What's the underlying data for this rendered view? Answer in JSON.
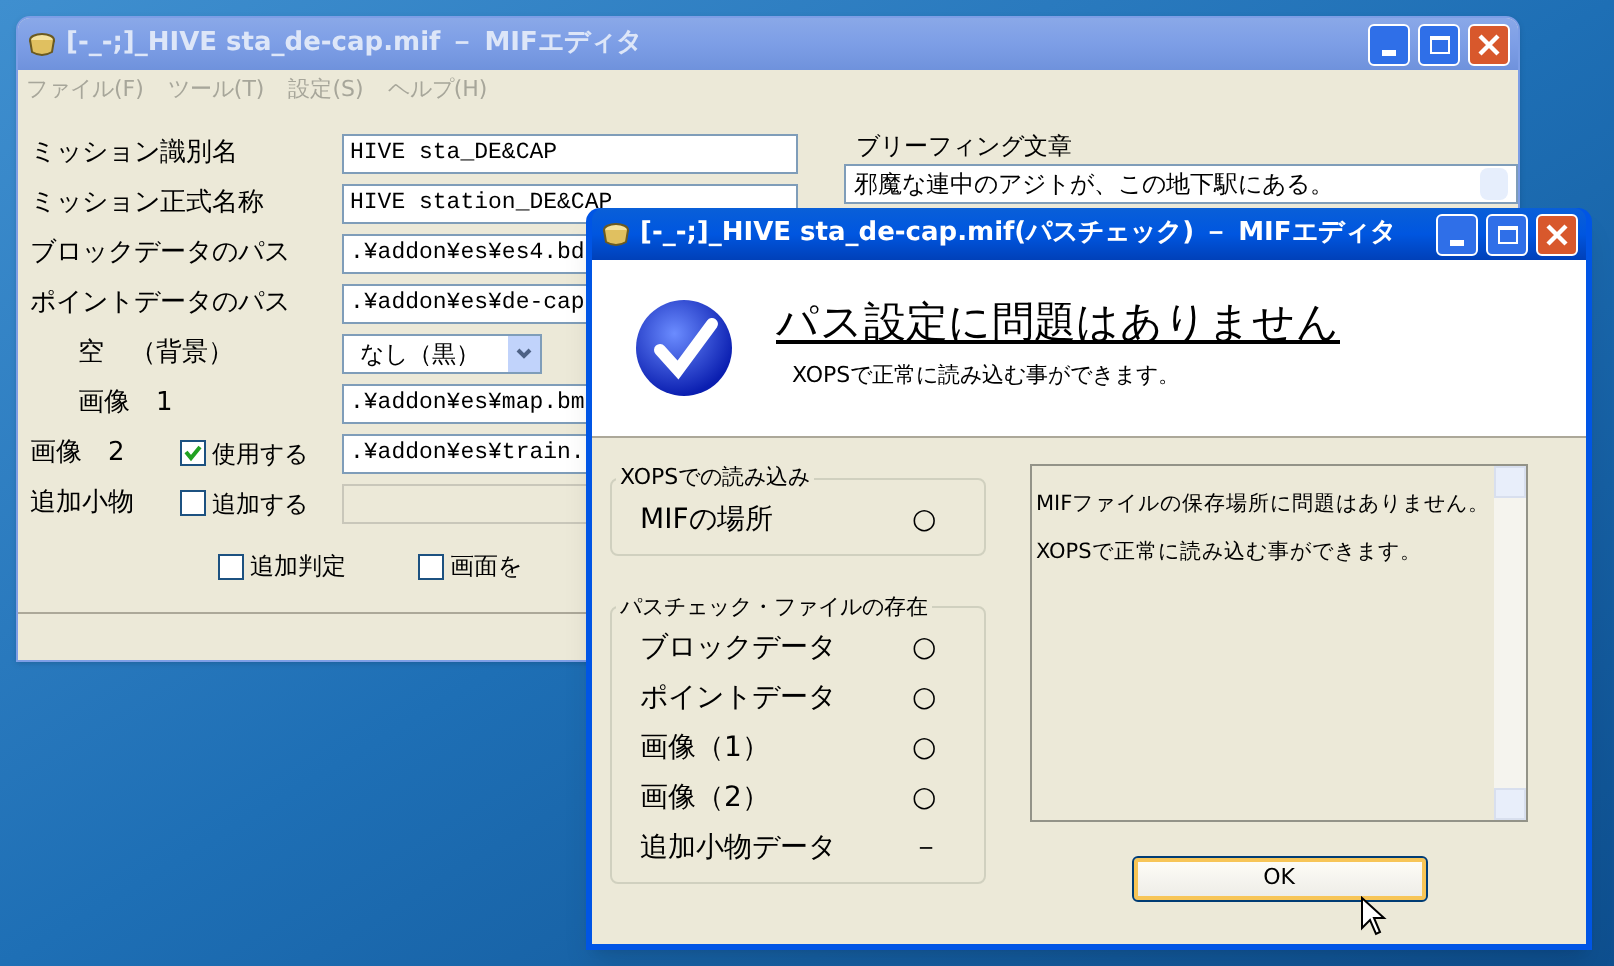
{
  "main_window": {
    "title": "[-_-;]_HIVE sta_de-cap.mif － MIFエディタ",
    "active": false,
    "menu": [
      {
        "label": "ファイル(F)",
        "disabled": true
      },
      {
        "label": "ツール(T)",
        "disabled": true
      },
      {
        "label": "設定(S)",
        "disabled": true
      },
      {
        "label": "ヘルプ(H)",
        "disabled": true
      }
    ],
    "fields": [
      {
        "kind": "text",
        "label": "ミッション識別名",
        "value": "HIVE sta_DE&CAP"
      },
      {
        "kind": "text",
        "label": "ミッション正式名称",
        "value": "HIVE station_DE&CAP"
      },
      {
        "kind": "text",
        "label": "ブロックデータのパス",
        "value": ".¥addon¥es¥es4.bd"
      },
      {
        "kind": "text",
        "label": "ポイントデータのパス",
        "value": ".¥addon¥es¥de-cap"
      },
      {
        "kind": "select",
        "label": "空　（背景）",
        "value": "なし（黒）"
      },
      {
        "kind": "subtext",
        "label": "画像　1",
        "value": ".¥addon¥es¥map.bm"
      },
      {
        "kind": "check",
        "label": "画像　2",
        "check_label": "使用する",
        "checked": true,
        "value": ".¥addon¥es¥train."
      },
      {
        "kind": "check",
        "label": "追加小物",
        "check_label": "追加する",
        "checked": false,
        "disabled": true
      }
    ],
    "briefing": {
      "label": "ブリーフィング文章",
      "value": "邪魔な連中のアジトが、この地下駅にある。"
    },
    "options": [
      {
        "label": "追加判定",
        "checked": false
      },
      {
        "label": "画面を",
        "checked": false
      }
    ]
  },
  "dialog": {
    "title": "[-_-;]_HIVE sta_de-cap.mif(パスチェック) － MIFエディタ",
    "active": true,
    "heading": "パス設定に問題はありません",
    "subheading": "XOPSで正常に読み込む事ができます。",
    "groups": [
      {
        "title": "XOPSでの読み込み",
        "items": [
          {
            "label": "MIFの場所",
            "result": "○"
          }
        ]
      },
      {
        "title": "パスチェック・ファイルの存在",
        "items": [
          {
            "label": "ブロックデータ",
            "result": "○"
          },
          {
            "label": "ポイントデータ",
            "result": "○"
          },
          {
            "label": "画像（1）",
            "result": "○"
          },
          {
            "label": "画像（2）",
            "result": "○"
          },
          {
            "label": "追加小物データ",
            "result": "－"
          }
        ]
      }
    ],
    "messages": [
      "MIFファイルの保存場所に問題はありません。",
      "XOPSで正常に読み込む事ができます。"
    ],
    "ok_button": "OK"
  }
}
